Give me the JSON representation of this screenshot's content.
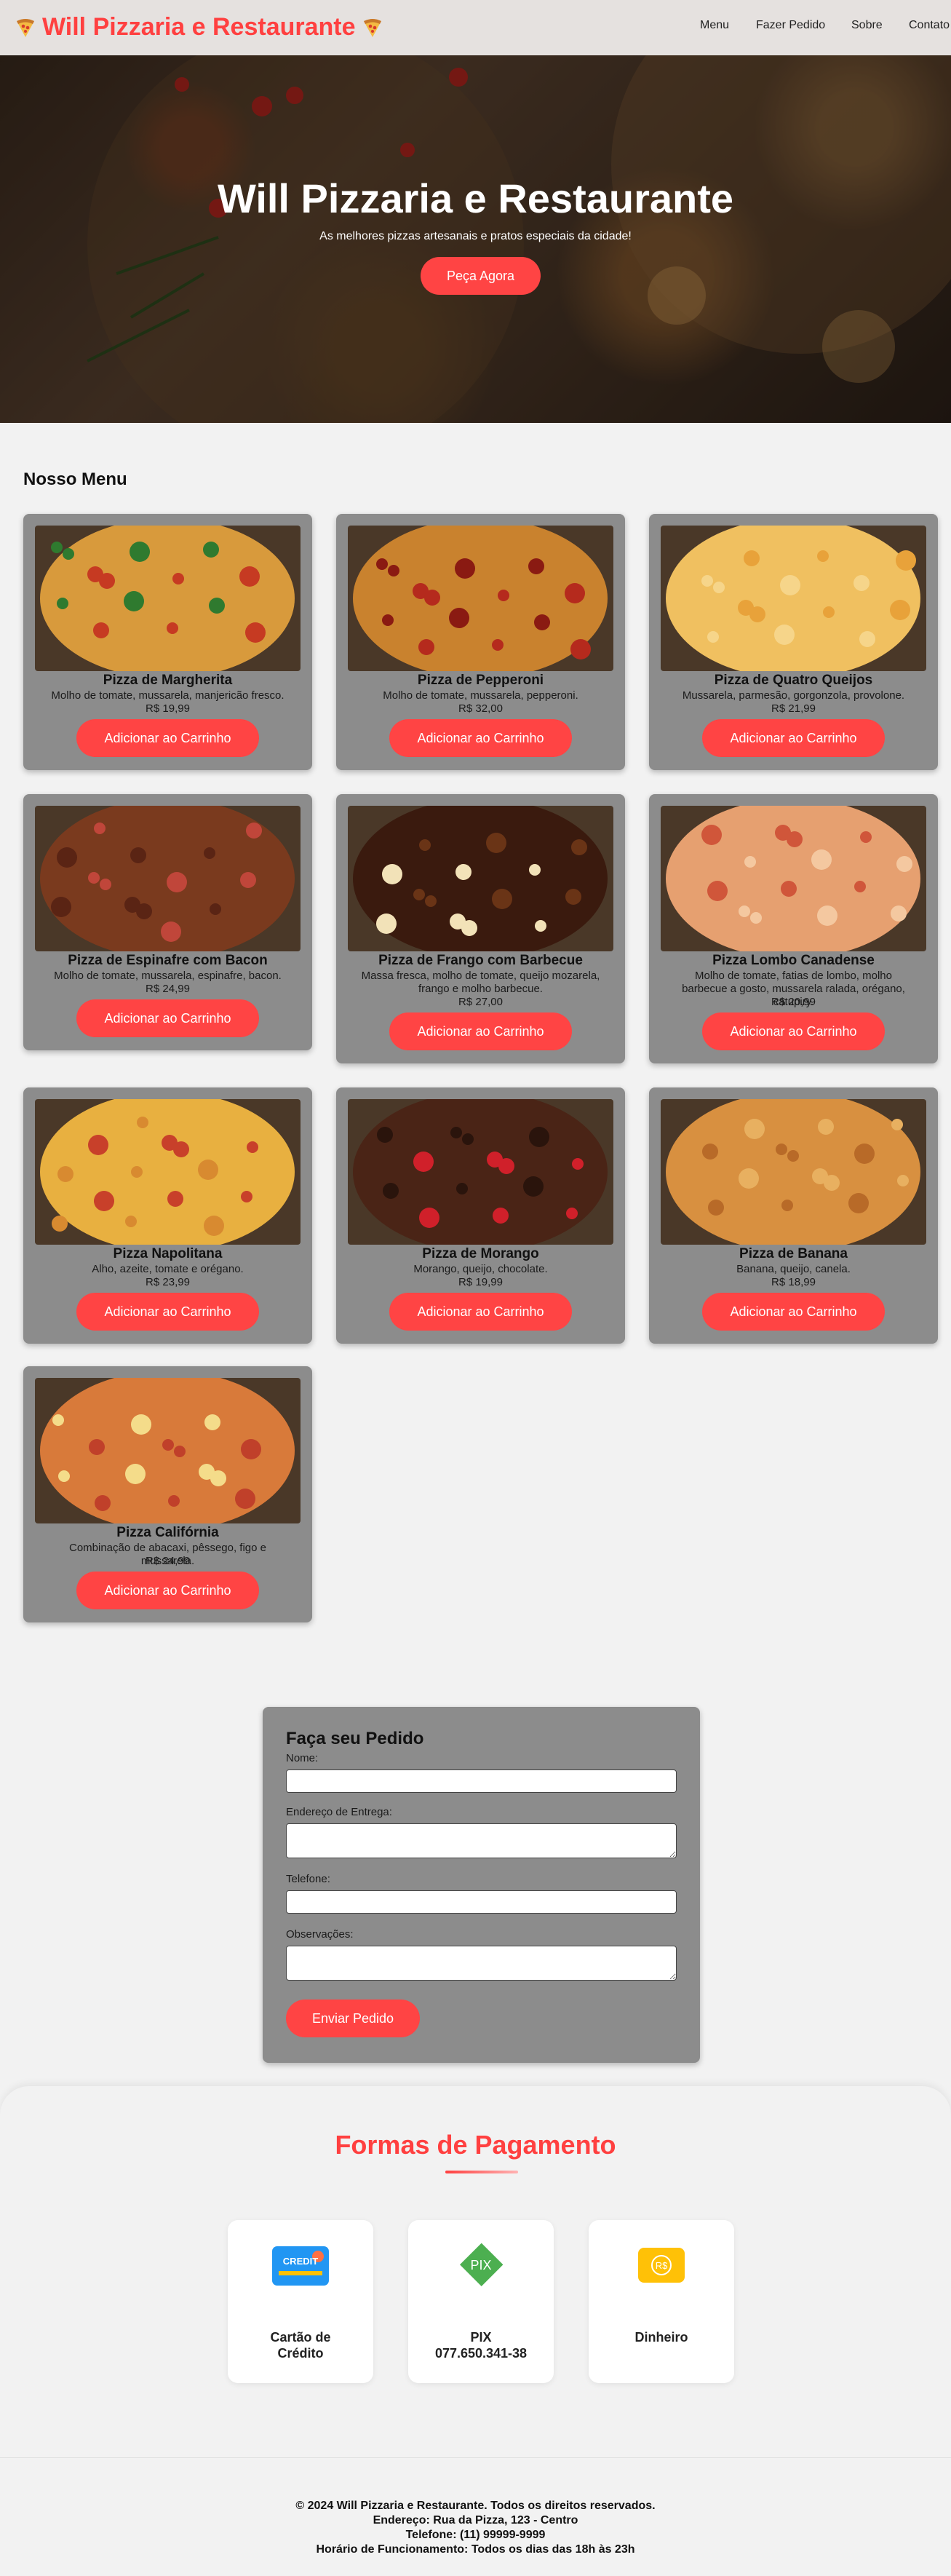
{
  "header": {
    "brand": "Will Pizzaria e Restaurante",
    "nav": [
      "Menu",
      "Fazer Pedido",
      "Sobre",
      "Contato"
    ]
  },
  "hero": {
    "title": "Will Pizzaria e Restaurante",
    "subtitle": "As melhores pizzas artesanais e pratos especiais da cidade!",
    "cta": "Peça Agora"
  },
  "menu": {
    "title": "Nosso Menu",
    "add_label": "Adicionar ao Carrinho",
    "items": [
      {
        "name": "Pizza de Margherita",
        "desc": "Molho de tomate, mussarela, manjericão fresco.",
        "price": "R$ 19,99"
      },
      {
        "name": "Pizza de Pepperoni",
        "desc": "Molho de tomate, mussarela, pepperoni.",
        "price": "R$ 32,00"
      },
      {
        "name": "Pizza de Quatro Queijos",
        "desc": "Mussarela, parmesão, gorgonzola, provolone.",
        "price": "R$ 21,99"
      },
      {
        "name": "Pizza de Espinafre com Bacon",
        "desc": "Molho de tomate, mussarela, espinafre, bacon.",
        "price": "R$ 24,99"
      },
      {
        "name": "Pizza de Frango com Barbecue",
        "desc": "Massa fresca, molho de tomate, queijo mozarela, frango e molho barbecue.",
        "price": "R$ 27,00"
      },
      {
        "name": "Pizza Lombo Canadense",
        "desc": "Molho de tomate, fatias de lombo, molho barbecue a gosto, mussarela ralada, orégano, catupiry.",
        "price": "R$ 20,99"
      },
      {
        "name": "Pizza Napolitana",
        "desc": "Alho, azeite, tomate e orégano.",
        "price": "R$ 23,99"
      },
      {
        "name": "Pizza de Morango",
        "desc": "Morango, queijo, chocolate.",
        "price": "R$ 19,99"
      },
      {
        "name": "Pizza de Banana",
        "desc": "Banana, queijo, canela.",
        "price": "R$ 18,99"
      },
      {
        "name": "Pizza Califórnia",
        "desc": "Combinação de abacaxi, pêssego, figo e mussarela.",
        "price": "R$ 24,99"
      }
    ]
  },
  "order": {
    "title": "Faça seu Pedido",
    "name_label": "Nome:",
    "address_label": "Endereço de Entrega:",
    "phone_label": "Telefone:",
    "notes_label": "Observações:",
    "submit": "Enviar Pedido"
  },
  "payment": {
    "title": "Formas de Pagamento",
    "card_icon_text": "CREDIT",
    "cash_icon_text": "R$",
    "pix_icon_text": "PIX",
    "methods": [
      {
        "label": "Cartão de Crédito",
        "icon": "credit-card-icon"
      },
      {
        "label": "PIX 077.650.341-38",
        "icon": "pix-icon"
      },
      {
        "label": "Dinheiro",
        "icon": "cash-icon"
      }
    ]
  },
  "footer": {
    "copyright": "© 2024 Will Pizzaria e Restaurante. Todos os direitos reservados.",
    "address": "Endereço: Rua da Pizza, 123 - Centro",
    "phone": "Telefone: (11) 99999-9999",
    "hours": "Horário de Funcionamento: Todos os dias das 18h às 23h"
  },
  "colors": {
    "accent": "#ff4444",
    "brand": "#ff4040",
    "card": "#8c8c8c"
  }
}
